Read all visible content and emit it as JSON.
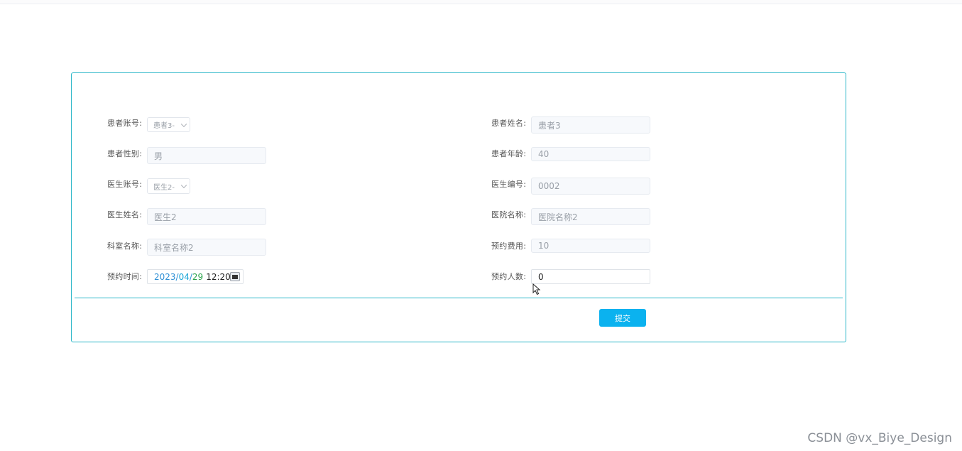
{
  "form": {
    "patient_account": {
      "label": "患者账号:",
      "value": "患者3-"
    },
    "patient_name": {
      "label": "患者姓名:",
      "value": "患者3"
    },
    "patient_gender": {
      "label": "患者性别:",
      "value": "男"
    },
    "patient_age": {
      "label": "患者年龄:",
      "value": "40"
    },
    "doctor_account": {
      "label": "医生账号:",
      "value": "医生2-"
    },
    "doctor_number": {
      "label": "医生编号:",
      "value": "0002"
    },
    "doctor_name": {
      "label": "医生姓名:",
      "value": "医生2"
    },
    "hospital_name": {
      "label": "医院名称:",
      "value": "医院名称2"
    },
    "department_name": {
      "label": "科室名称:",
      "value": "科室名称2"
    },
    "appointment_fee": {
      "label": "预约费用:",
      "value": "10"
    },
    "appointment_time": {
      "label": "预约时间:",
      "year": "2023",
      "month": "04",
      "day": "29",
      "time": "12:20",
      "sep": "/"
    },
    "appointment_count": {
      "label": "预约人数:",
      "value": "0"
    },
    "submit_label": "提交"
  },
  "watermark": "CSDN @vx_Biye_Design",
  "colors": {
    "accent": "#29b6c8",
    "submit": "#0bb2ef"
  }
}
